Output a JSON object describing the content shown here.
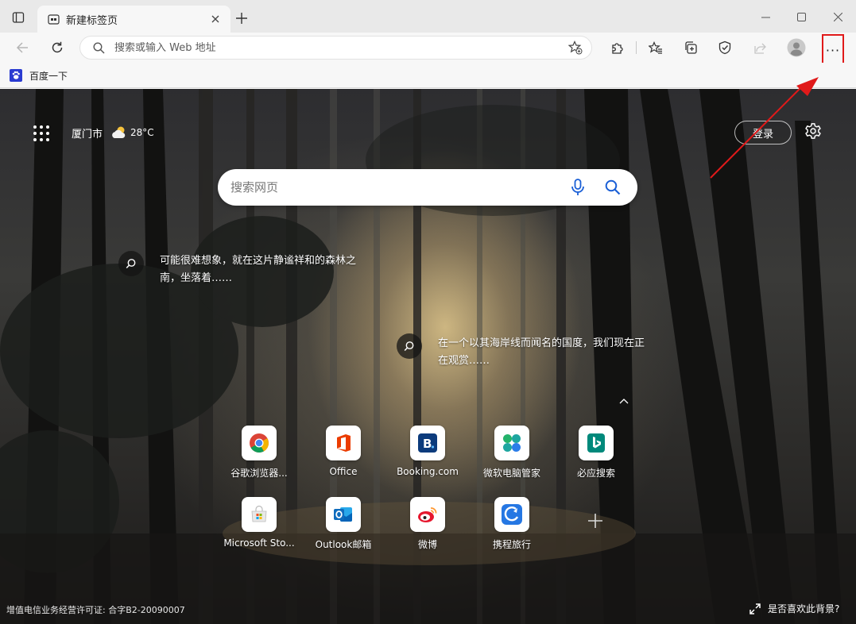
{
  "browser": {
    "tab": {
      "title": "新建标签页",
      "favicon": "newtab-icon",
      "close_icon": "close-icon"
    },
    "new_tab_icon": "plus-icon",
    "window_controls": [
      "minimize-icon",
      "maximize-icon",
      "close-icon"
    ]
  },
  "toolbar": {
    "address_placeholder": "搜索或输入 Web 地址",
    "address_value": "",
    "icons": [
      "back-icon",
      "refresh-icon",
      "search-icon",
      "add-favorite-icon",
      "extensions-icon",
      "favorites-icon",
      "collections-icon",
      "performance-icon",
      "share-icon",
      "profile-icon"
    ],
    "more_label": "···"
  },
  "bookmarks": [
    {
      "label": "百度一下",
      "icon": "baidu-paw-icon"
    }
  ],
  "ntp": {
    "weather": {
      "city": "厦门市",
      "temp": "28°C",
      "icon": "partly-cloudy-icon"
    },
    "login_label": "登录",
    "search_placeholder": "搜索网页",
    "hotspots": [
      {
        "text": "可能很难想象，就在这片静谧祥和的森林之南，坐落着……"
      },
      {
        "text": "在一个以其海岸线而闻名的国度，我们现在正在观赏……"
      }
    ],
    "quick_links": [
      {
        "label": "谷歌浏览器...",
        "icon": "chrome-icon"
      },
      {
        "label": "Office",
        "icon": "office-icon"
      },
      {
        "label": "Booking.com",
        "icon": "booking-icon"
      },
      {
        "label": "微软电脑管家",
        "icon": "pc-manager-icon"
      },
      {
        "label": "必应搜索",
        "icon": "bing-icon"
      },
      {
        "label": "Microsoft Sto...",
        "icon": "microsoft-store-icon"
      },
      {
        "label": "Outlook邮箱",
        "icon": "outlook-icon"
      },
      {
        "label": "微博",
        "icon": "weibo-icon"
      },
      {
        "label": "携程旅行",
        "icon": "ctrip-icon"
      }
    ],
    "footer_left": "增值电信业务经营许可证: 合字B2-20090007",
    "footer_right": "是否喜欢此背景?"
  },
  "colors": {
    "highlight": "#e01a1a",
    "chrome_bg": "#f7f7f7",
    "tabstrip_bg": "#e9e9e9"
  }
}
